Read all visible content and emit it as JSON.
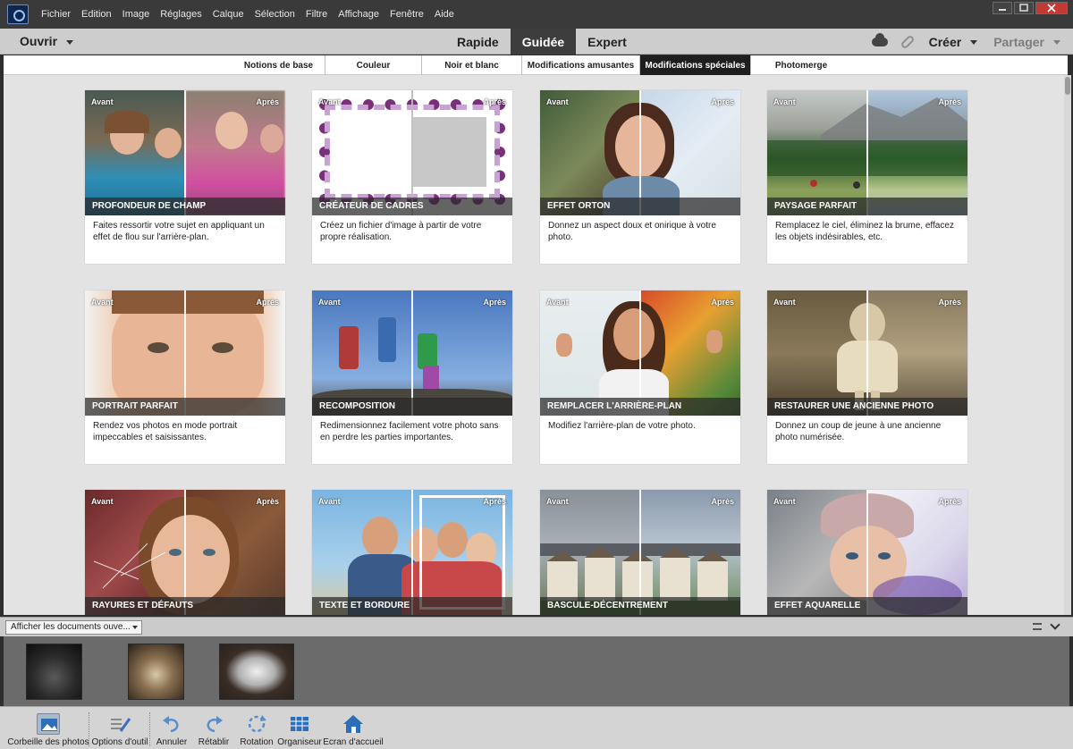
{
  "menubar": {
    "items": [
      "Fichier",
      "Edition",
      "Image",
      "Réglages",
      "Calque",
      "Sélection",
      "Filtre",
      "Affichage",
      "Fenêtre",
      "Aide"
    ]
  },
  "modebar": {
    "open_label": "Ouvrir",
    "tabs": [
      "Rapide",
      "Guidée",
      "Expert"
    ],
    "active_tab": "Guidée",
    "create_label": "Créer",
    "share_label": "Partager"
  },
  "categories": {
    "items": [
      "Notions de base",
      "Couleur",
      "Noir et blanc",
      "Modifications amusantes",
      "Modifications spéciales",
      "Photomerge"
    ],
    "active": "Modifications spéciales"
  },
  "card_labels": {
    "before": "Avant",
    "after": "Après"
  },
  "cards": [
    {
      "title": "PROFONDEUR DE CHAMP",
      "desc": "Faites ressortir votre sujet en appliquant un effet de flou sur l'arrière-plan."
    },
    {
      "title": "CRÉATEUR DE CADRES",
      "desc": "Créez un fichier d'image à partir de votre propre réalisation."
    },
    {
      "title": "EFFET ORTON",
      "desc": "Donnez un aspect doux et onirique à votre photo."
    },
    {
      "title": "PAYSAGE PARFAIT",
      "desc": "Remplacez le ciel, éliminez la brume, effacez les objets indésirables, etc."
    },
    {
      "title": "PORTRAIT PARFAIT",
      "desc": "Rendez vos photos en mode portrait impeccables et saisissantes."
    },
    {
      "title": "RECOMPOSITION",
      "desc": "Redimensionnez facilement votre photo sans en perdre les parties importantes."
    },
    {
      "title": "REMPLACER L'ARRIÈRE-PLAN",
      "desc": "Modifiez l'arrière-plan de votre photo."
    },
    {
      "title": "RESTAURER UNE ANCIENNE PHOTO",
      "desc": "Donnez un coup de jeune à une ancienne photo numérisée."
    },
    {
      "title": "RAYURES ET DÉFAUTS",
      "desc": ""
    },
    {
      "title": "TEXTE ET BORDURE",
      "desc": ""
    },
    {
      "title": "BASCULE-DÉCENTREMENT",
      "desc": ""
    },
    {
      "title": "EFFET AQUARELLE",
      "desc": ""
    }
  ],
  "docbar": {
    "select_value": "Afficher les documents ouve..."
  },
  "toolbar": {
    "items": [
      "Corbeille des photos",
      "Options d'outil",
      "Annuler",
      "Rétablir",
      "Rotation",
      "Organiseur",
      "Ecran d'accueil"
    ]
  },
  "colors": {
    "accent_dark": "#3d3d3d",
    "canvas": "#e3e3e3",
    "close_button": "#c23a33"
  }
}
